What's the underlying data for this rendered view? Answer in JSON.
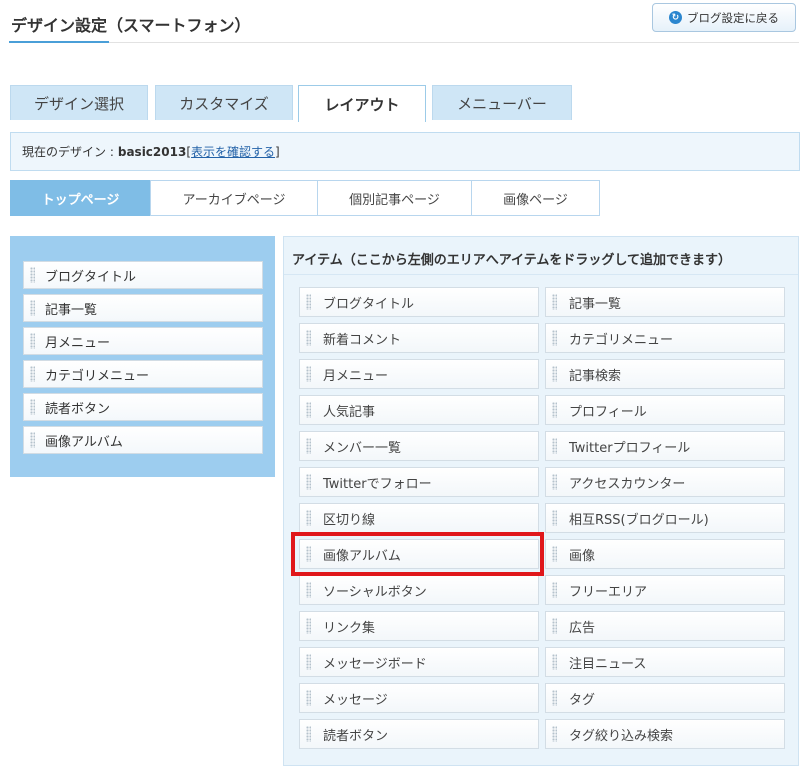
{
  "page": {
    "title": "デザイン設定（スマートフォン）"
  },
  "back_button": {
    "label": "ブログ設定に戻る"
  },
  "main_tabs": [
    {
      "label": "デザイン選択"
    },
    {
      "label": "カスタマイズ"
    },
    {
      "label": "レイアウト",
      "active": true
    },
    {
      "label": "メニューバー"
    }
  ],
  "current_design": {
    "label": "現在のデザイン :",
    "name": "basic2013",
    "link_open": "[",
    "link": "表示を確認する",
    "link_close": "]"
  },
  "sub_tabs": [
    {
      "label": "トップページ",
      "active": true
    },
    {
      "label": "アーカイブページ"
    },
    {
      "label": "個別記事ページ"
    },
    {
      "label": "画像ページ"
    }
  ],
  "layout_items": [
    "ブログタイトル",
    "記事一覧",
    "月メニュー",
    "カテゴリメニュー",
    "読者ボタン",
    "画像アルバム"
  ],
  "items_panel": {
    "heading": "アイテム（ここから左側のエリアへアイテムをドラッグして追加できます）",
    "items": [
      "ブログタイトル",
      "記事一覧",
      "新着コメント",
      "カテゴリメニュー",
      "月メニュー",
      "記事検索",
      "人気記事",
      "プロフィール",
      "メンバー一覧",
      "Twitterプロフィール",
      "Twitterでフォロー",
      "アクセスカウンター",
      "区切り線",
      "相互RSS(ブログロール)",
      "画像アルバム",
      "画像",
      "ソーシャルボタン",
      "フリーエリア",
      "リンク集",
      "広告",
      "メッセージボード",
      "注目ニュース",
      "メッセージ",
      "タグ",
      "読者ボタン",
      "タグ絞り込み検索"
    ]
  },
  "colors": {
    "accent": "#4a9fd8",
    "tab_bg": "#cfe6f6",
    "active_subtab": "#7fbde6",
    "highlight": "#e0171b"
  }
}
